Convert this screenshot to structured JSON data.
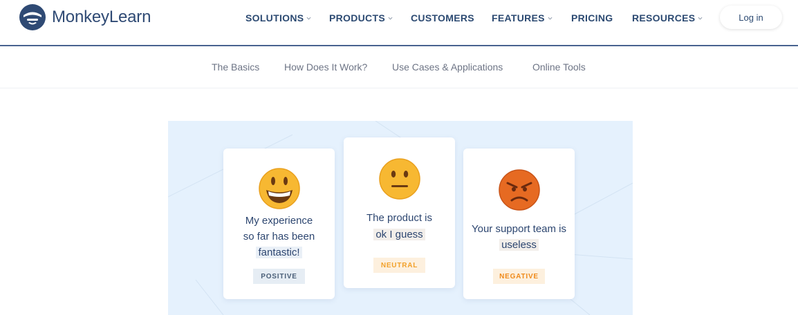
{
  "brand": {
    "name": "MonkeyLearn",
    "logo_icon": "monkey-logo-icon"
  },
  "nav": {
    "items": [
      {
        "label": "SOLUTIONS",
        "has_dropdown": true
      },
      {
        "label": "PRODUCTS",
        "has_dropdown": true
      },
      {
        "label": "CUSTOMERS",
        "has_dropdown": false
      },
      {
        "label": "FEATURES",
        "has_dropdown": true
      },
      {
        "label": "PRICING",
        "has_dropdown": false
      },
      {
        "label": "RESOURCES",
        "has_dropdown": true
      }
    ],
    "login_label": "Log in"
  },
  "subnav": {
    "items": [
      "The Basics",
      "How Does It Work?",
      "Use Cases & Applications",
      "Online Tools"
    ]
  },
  "hero": {
    "cards": [
      {
        "emoji": "grinning-face-icon",
        "text_line1": "My experience",
        "text_line2": "so far has been",
        "text_highlight": "fantastic!",
        "badge": "POSITIVE"
      },
      {
        "emoji": "neutral-face-icon",
        "text_line1": "The product is",
        "text_highlight": "ok I guess",
        "badge": "NEUTRAL"
      },
      {
        "emoji": "angry-face-icon",
        "text_line1": "Your support team is",
        "text_highlight": "useless",
        "badge": "NEGATIVE"
      }
    ]
  },
  "colors": {
    "brand_navy": "#2f4a74",
    "hero_background": "#e5f1fd",
    "positive": "#4a5f78",
    "neutral": "#f2a12a",
    "negative": "#ef8a1b"
  }
}
